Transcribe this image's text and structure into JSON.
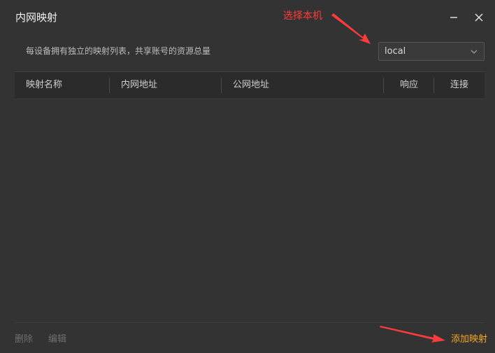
{
  "window": {
    "title": "内网映射"
  },
  "annotations": {
    "select_host": "选择本机"
  },
  "description": "每设备拥有独立的映射列表，共享账号的资源总量",
  "device_select": {
    "selected": "local"
  },
  "table": {
    "columns": [
      "映射名称",
      "内网地址",
      "公网地址",
      "响应",
      "连接"
    ],
    "rows": []
  },
  "footer": {
    "delete_label": "删除",
    "edit_label": "编辑",
    "add_label": "添加映射"
  },
  "colors": {
    "background": "#333333",
    "header_background": "#2b2b2b",
    "accent": "#f5a623",
    "annotation": "#ff3b3b",
    "disabled_text": "#6f6f6f"
  }
}
